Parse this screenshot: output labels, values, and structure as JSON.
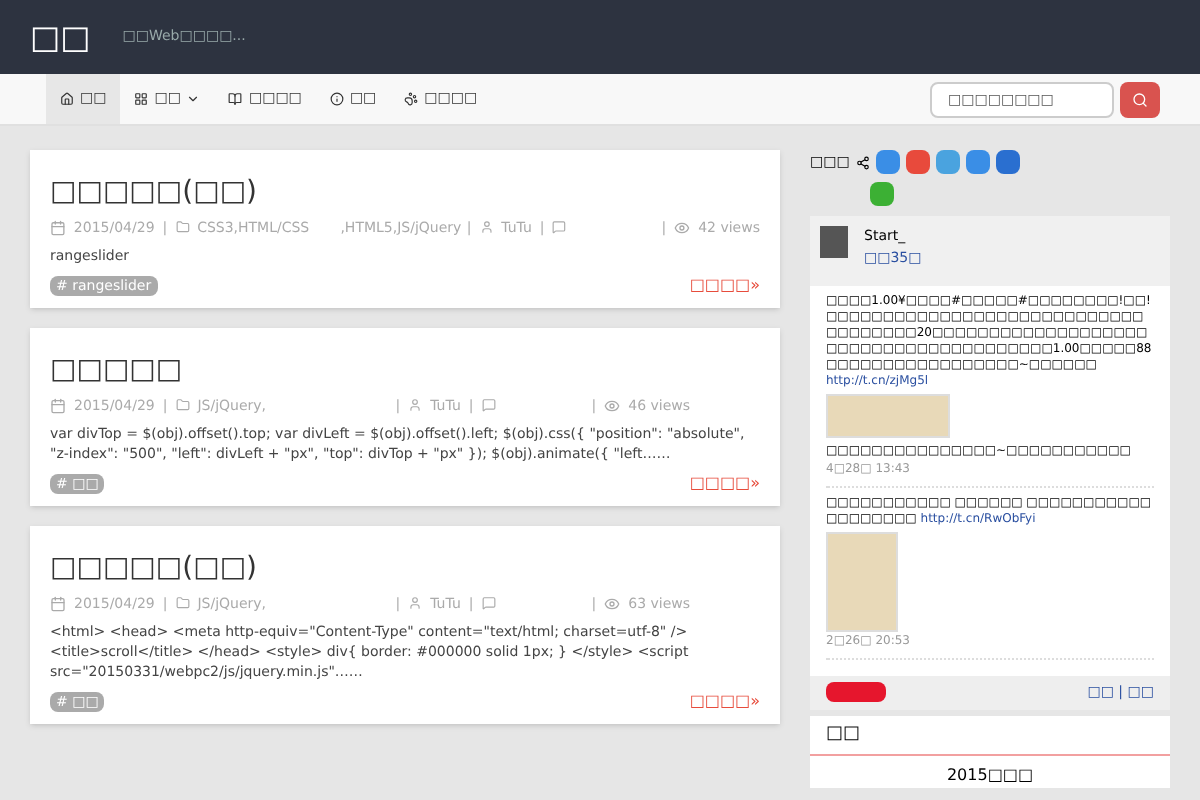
{
  "header": {
    "logo": "□□",
    "tagline": "□□Web□□□□..."
  },
  "nav": {
    "items": [
      {
        "label": "□□",
        "selected": true,
        "dropdown": false
      },
      {
        "label": "□□",
        "selected": false,
        "dropdown": true
      },
      {
        "label": "□□□□",
        "selected": false,
        "dropdown": false
      },
      {
        "label": "□□",
        "selected": false,
        "dropdown": false
      },
      {
        "label": "□□□□",
        "selected": false,
        "dropdown": false
      }
    ],
    "search": {
      "placeholder": "□□□□□□□□"
    }
  },
  "meta_separator": "|",
  "posts": [
    {
      "title": "□□□□□(□□)",
      "date": "2015/04/29",
      "category": "CSS3,HTML/CSS       ,HTML5,JS/jQuery",
      "author": "TuTu",
      "views": "42 views",
      "excerpt": "rangeslider",
      "tag": "# rangeslider",
      "more": "□□□□»"
    },
    {
      "title": "□□□□□",
      "date": "2015/04/29",
      "category": "JS/jQuery,",
      "author": "TuTu",
      "views": "46 views",
      "excerpt": "var divTop = $(obj).offset().top; var divLeft = $(obj).offset().left; $(obj).css({ \"position\": \"absolute\", \"z-index\": \"500\", \"left\": divLeft + \"px\", \"top\": divTop + \"px\" }); $(obj).animate({ \"left……",
      "tag": "# □□",
      "more": "□□□□»"
    },
    {
      "title": "□□□□□(□□)",
      "date": "2015/04/29",
      "category": "JS/jQuery,",
      "author": "TuTu",
      "views": "63 views",
      "excerpt": "<html> <head> <meta http-equiv=\"Content-Type\" content=\"text/html; charset=utf-8\" /> <title>scroll</title> </head> <style> div{ border: #000000 solid 1px; } </style> <script src=\"20150331/webpc2/js/jquery.min.js\"……",
      "tag": "# □□",
      "more": "□□□□»"
    }
  ],
  "sidebar": {
    "share_label": "□□□",
    "profile": {
      "name": "Start_",
      "followers": "□□35□"
    },
    "weibo_posts": [
      {
        "text": "□□□□1.00¥□□□□#□□□□□#□□□□□□□□!□□!□□□□□□□□□□□□□□□□□□□□□□□□□□□□□□□□□□□□20□□□□□□□□□□□□□□□□□□□□□□□□□□□□□□□□□□□□□□□1.00□□□□□88□□□□□□□□□□□□□□□□□~□□□□□□",
        "link": "http://t.cn/zjMg5l",
        "caption": "□□□□□□□□□□□□□□□~□□□□□□□□□□□",
        "time": "4□28□ 13:43"
      },
      {
        "text": "□□□□□□□□□□□ □□□□□□ □□□□□□□□□□□ □□□□□□□□",
        "link": "http://t.cn/RwObFyi",
        "time": "2□26□ 20:53"
      }
    ],
    "weibo_links": "□□ | □□",
    "archive": {
      "title": "□□",
      "year": "2015□□□"
    }
  }
}
